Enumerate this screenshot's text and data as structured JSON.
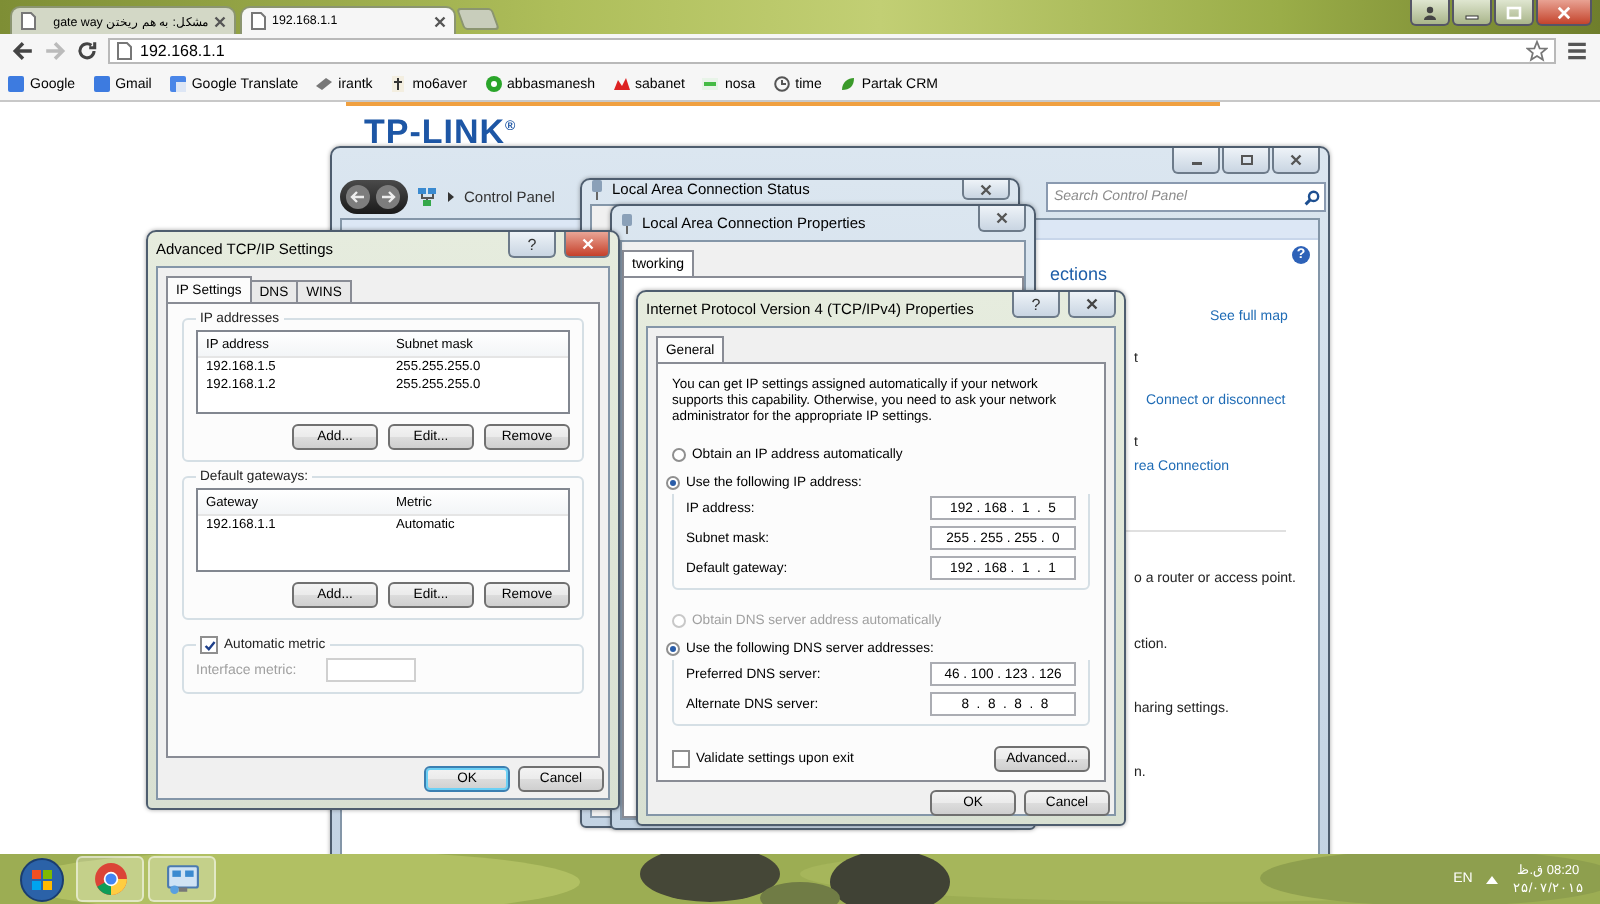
{
  "browser": {
    "tabs": [
      {
        "title": "مشکل: به هم ریختن gate way",
        "selected": false
      },
      {
        "title": "192.168.1.1",
        "selected": true
      }
    ],
    "address": "192.168.1.1",
    "bookmarks": [
      "Google",
      "Gmail",
      "Google Translate",
      "irantk",
      "mo6aver",
      "abbasmanesh",
      "sabanet",
      "nosa",
      "time",
      "Partak CRM"
    ]
  },
  "page": {
    "logo": "TP-LINK$^{®}$"
  },
  "control_panel": {
    "breadcrumb": "Control Panel",
    "search": {
      "placeholder": "Search Control Panel"
    },
    "help": "?",
    "items": [
      {
        "text": "ections",
        "kind": "heading"
      },
      {
        "text": "See full map",
        "kind": "link"
      },
      {
        "text": "t",
        "kind": "text"
      },
      {
        "text": "Connect or disconnect",
        "kind": "link"
      },
      {
        "text": "t",
        "kind": "text"
      },
      {
        "text": "rea Connection",
        "kind": "link"
      },
      {
        "text": "o a router or access point.",
        "kind": "text"
      },
      {
        "text": "ction.",
        "kind": "text"
      },
      {
        "text": "haring settings.",
        "kind": "text"
      },
      {
        "text": "n.",
        "kind": "text"
      }
    ]
  },
  "status_window": {
    "title": "Local Area Connection Status"
  },
  "properties_window": {
    "title": "Local Area Connection Properties",
    "tabs": [
      {
        "label": "tworking",
        "selected": true
      }
    ]
  },
  "advanced": {
    "title": "Advanced TCP/IP Settings",
    "help": "?",
    "tabs": [
      {
        "label": "IP Settings",
        "selected": true
      },
      {
        "label": "DNS",
        "selected": false
      },
      {
        "label": "WINS",
        "selected": false
      }
    ],
    "ip_group": {
      "label": "IP addresses",
      "columns": [
        "IP address",
        "Subnet mask"
      ],
      "rows": [
        [
          "192.168.1.5",
          "255.255.255.0"
        ],
        [
          "192.168.1.2",
          "255.255.255.0"
        ]
      ],
      "buttons": [
        "Add...",
        "Edit...",
        "Remove"
      ]
    },
    "gateway_group": {
      "label": "Default gateways:",
      "columns": [
        "Gateway",
        "Metric"
      ],
      "rows": [
        [
          "192.168.1.1",
          "Automatic"
        ]
      ],
      "buttons": [
        "Add...",
        "Edit...",
        "Remove"
      ]
    },
    "automatic_metric": {
      "label": "Automatic metric",
      "checked": true
    },
    "interface_metric": {
      "label": "Interface metric:",
      "disabled": true
    },
    "buttons": [
      {
        "label": "OK",
        "default": true
      },
      {
        "label": "Cancel",
        "default": false
      }
    ]
  },
  "ipv4": {
    "title": "Internet Protocol Version 4 (TCP/IPv4) Properties",
    "help": "?",
    "tabs": [
      {
        "label": "General",
        "selected": true
      }
    ],
    "intro": "You can get IP settings assigned automatically if your network supports this capability. Otherwise, you need to ask your network administrator for the appropriate IP settings.",
    "ip_options": [
      {
        "label": "Obtain an IP address automatically",
        "selected": false,
        "disabled": false
      },
      {
        "label": "Use the following IP address:",
        "selected": true,
        "disabled": false
      }
    ],
    "ip_fields": [
      {
        "label": "IP address:",
        "value": "192 . 168 .  1  .  5"
      },
      {
        "label": "Subnet mask:",
        "value": "255 . 255 . 255 .  0"
      },
      {
        "label": "Default gateway:",
        "value": "192 . 168 .  1  .  1"
      }
    ],
    "dns_options": [
      {
        "label": "Obtain DNS server address automatically",
        "selected": false,
        "disabled": true
      },
      {
        "label": "Use the following DNS server addresses:",
        "selected": true,
        "disabled": false
      }
    ],
    "dns_fields": [
      {
        "label": "Preferred DNS server:",
        "value": "46 . 100 . 123 . 126"
      },
      {
        "label": "Alternate DNS server:",
        "value": " 8  .  8  .  8  .  8"
      }
    ],
    "validate": {
      "label": "Validate settings upon exit",
      "checked": false
    },
    "advanced_button": "Advanced...",
    "buttons": [
      {
        "label": "OK",
        "default": false
      },
      {
        "label": "Cancel",
        "default": false
      }
    ]
  },
  "taskbar": {
    "apps": [
      {
        "kind": "chrome"
      },
      {
        "kind": "network"
      }
    ],
    "language": "EN",
    "time": "08:20 ق.ظ",
    "date": "۲۵/۰۷/۲۰۱۵"
  }
}
